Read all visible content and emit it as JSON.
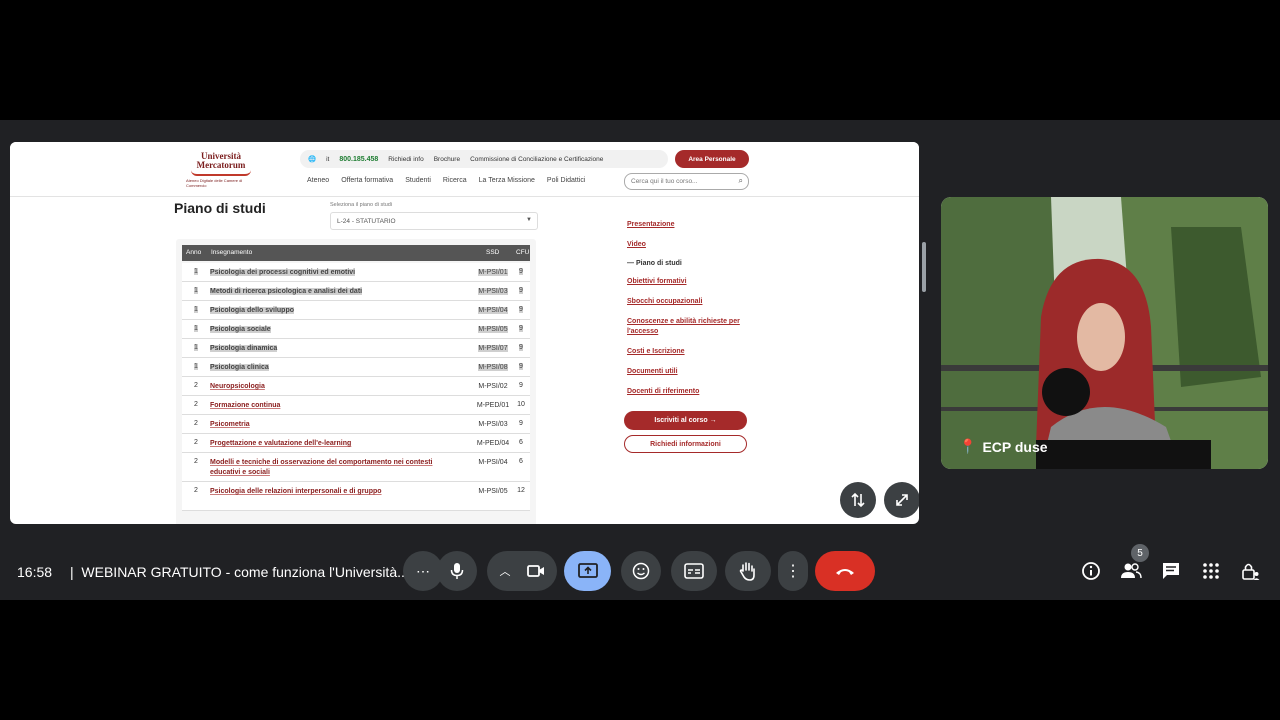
{
  "meeting": {
    "time": "16:58",
    "separator": "|",
    "title": "WEBINAR GRATUITO - come funziona l'Università...",
    "participant_count": "5"
  },
  "participant": {
    "name": "ECP duse"
  },
  "site": {
    "logo_line1": "Università",
    "logo_line2": "Mercatorum",
    "logo_sub": "Ateneo Digitale delle Camere di Commercio",
    "lang": "it",
    "phone": "800.185.458",
    "topbar_links": [
      "Richiedi info",
      "Brochure",
      "Commissione di Conciliazione e Certificazione"
    ],
    "area_personale": "Area Personale",
    "nav": [
      "Ateneo",
      "Offerta formativa",
      "Studenti",
      "Ricerca",
      "La Terza Missione",
      "Poli Didattici"
    ],
    "search_placeholder": "Cerca qui il tuo corso...",
    "page_title": "Piano di studi",
    "select_label": "Seleziona il piano di studi",
    "select_value": "L-24 - STATUTARIO",
    "table_headers": [
      "Anno",
      "Insegnamento",
      "SSD",
      "CFU"
    ],
    "rows": [
      {
        "anno": "1",
        "ins": "Psicologia dei processi cognitivi ed emotivi",
        "ssd": "M-PSI/01",
        "cfu": "9"
      },
      {
        "anno": "1",
        "ins": "Metodi di ricerca psicologica e analisi dei dati",
        "ssd": "M-PSI/03",
        "cfu": "9"
      },
      {
        "anno": "1",
        "ins": "Psicologia dello sviluppo",
        "ssd": "M-PSI/04",
        "cfu": "9"
      },
      {
        "anno": "1",
        "ins": "Psicologia sociale",
        "ssd": "M-PSI/05",
        "cfu": "9"
      },
      {
        "anno": "1",
        "ins": "Psicologia dinamica",
        "ssd": "M-PSI/07",
        "cfu": "9"
      },
      {
        "anno": "1",
        "ins": "Psicologia clinica",
        "ssd": "M-PSI/08",
        "cfu": "9"
      },
      {
        "anno": "2",
        "ins": "Neuropsicologia",
        "ssd": "M-PSI/02",
        "cfu": "9"
      },
      {
        "anno": "2",
        "ins": "Formazione continua",
        "ssd": "M-PED/01",
        "cfu": "10"
      },
      {
        "anno": "2",
        "ins": "Psicometria",
        "ssd": "M-PSI/03",
        "cfu": "9"
      },
      {
        "anno": "2",
        "ins": "Progettazione e valutazione dell'e-learning",
        "ssd": "M-PED/04",
        "cfu": "6"
      },
      {
        "anno": "2",
        "ins": "Modelli e tecniche di osservazione del comportamento nei contesti educativi e sociali",
        "ssd": "M-PSI/04",
        "cfu": "6"
      },
      {
        "anno": "2",
        "ins": "Psicologia delle relazioni interpersonali e di gruppo",
        "ssd": "M-PSI/05",
        "cfu": "12"
      }
    ],
    "side_links": [
      "Presentazione",
      "Video",
      "Piano di studi",
      "Obiettivi formativi",
      "Sbocchi occupazionali",
      "Conoscenze e abilità richieste per l'accesso",
      "Costi e Iscrizione",
      "Documenti utili",
      "Docenti di riferimento"
    ],
    "current_side": "Piano di studi",
    "btn_iscriviti": "Iscriviti al corso →",
    "btn_info": "Richiedi informazioni"
  },
  "colors": {
    "brand_red": "#a52a2a",
    "end_call": "#d93025",
    "present_active": "#8ab4f8"
  }
}
